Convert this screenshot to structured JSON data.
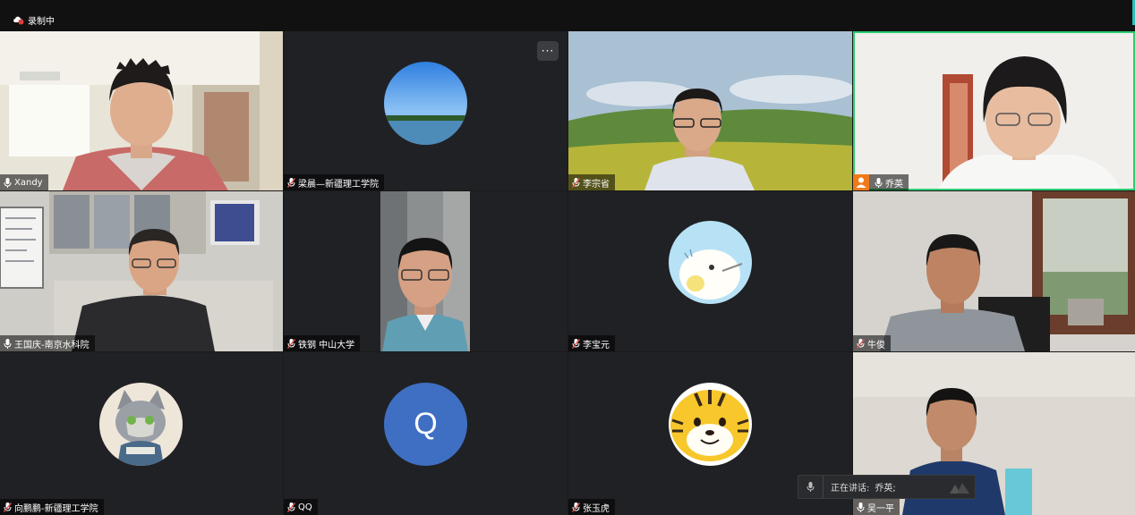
{
  "recording": {
    "label": "录制中"
  },
  "tiles": [
    {
      "name": "Xandy",
      "muted": false
    },
    {
      "name": "梁晨—新疆理工学院",
      "muted": true
    },
    {
      "name": "李宗省",
      "muted": true
    },
    {
      "name": "乔英",
      "muted": false
    },
    {
      "name": "王国庆-南京水科院",
      "muted": false
    },
    {
      "name": "铁钢 中山大学",
      "muted": true
    },
    {
      "name": "李宝元",
      "muted": true
    },
    {
      "name": "牛俊",
      "muted": true
    },
    {
      "name": "向鹏鹏-新疆理工学院",
      "muted": true
    },
    {
      "name": "QQ",
      "muted": true
    },
    {
      "name": "张玉虎",
      "muted": true
    },
    {
      "name": "吴一平",
      "muted": false
    }
  ],
  "avatar_letter": "Q",
  "more_button": {
    "label": "···"
  },
  "speaking": {
    "label": "正在讲话:",
    "name": "乔英;"
  },
  "colors": {
    "active_border": "#2ecc71",
    "muted_mic": "#e05252",
    "q_avatar": "#3f6fc3",
    "tile_bg": "#202124"
  }
}
